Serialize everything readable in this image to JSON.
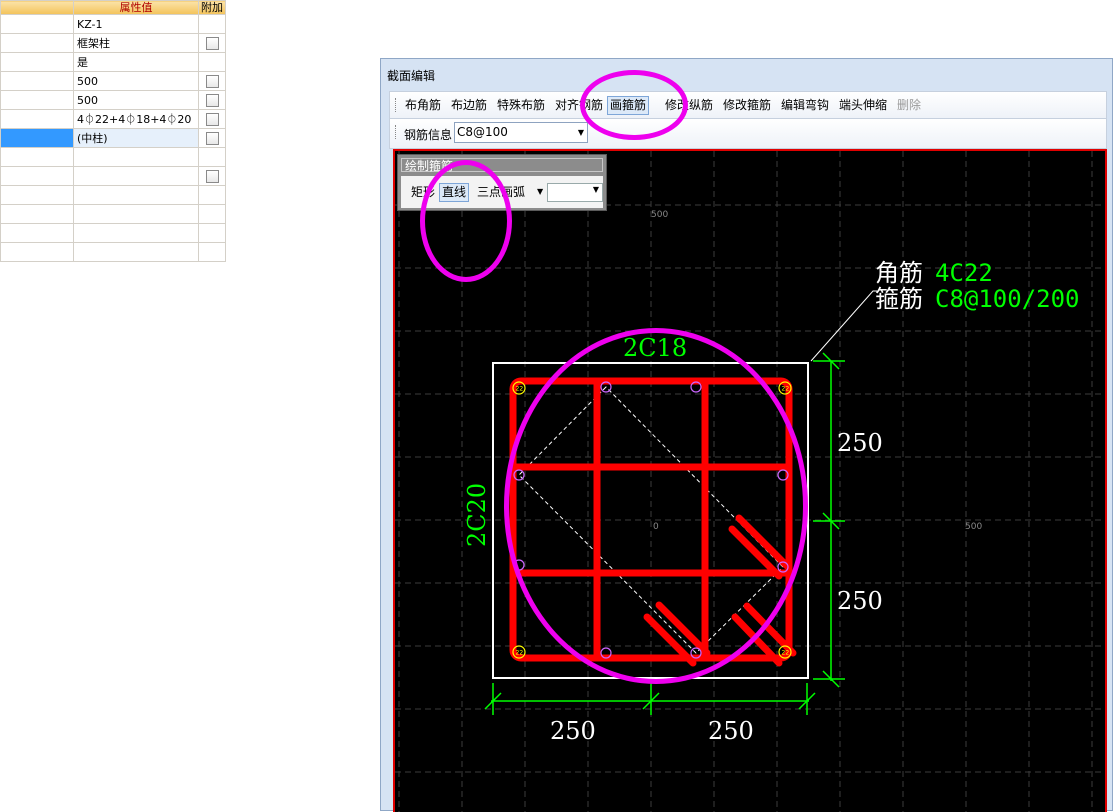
{
  "property_grid": {
    "headers": [
      "属性值",
      "附加"
    ],
    "rows": [
      {
        "value": "KZ-1",
        "checkbox": false
      },
      {
        "value": "框架柱",
        "checkbox": true
      },
      {
        "value": "是",
        "checkbox": false
      },
      {
        "value": "500",
        "checkbox": true
      },
      {
        "value": "500",
        "checkbox": true
      },
      {
        "value": "4⏀22+4⏀18+4⏀20",
        "checkbox": true
      },
      {
        "value": "(中柱)",
        "checkbox": true,
        "selected": true
      },
      {
        "value": "",
        "checkbox": false
      },
      {
        "value": "",
        "checkbox": true
      },
      {
        "value": "",
        "checkbox": false
      },
      {
        "value": "",
        "checkbox": false
      },
      {
        "value": "",
        "checkbox": false
      },
      {
        "value": "",
        "checkbox": false
      }
    ]
  },
  "dialog": {
    "title": "截面编辑",
    "toolbar": [
      "布角筋",
      "布边筋",
      "特殊布筋",
      "对齐钢筋",
      "画箍筋",
      "修改纵筋",
      "修改箍筋",
      "编辑弯钩",
      "端头伸缩",
      "删除"
    ],
    "active_tool": "画箍筋",
    "disabled_tool": "删除",
    "rebar_info_label": "钢筋信息",
    "rebar_info_value": "C8@100"
  },
  "draw_panel": {
    "title": "绘制箍筋",
    "buttons": [
      "矩形",
      "直线",
      "三点画弧"
    ],
    "active": "直线"
  },
  "drawing": {
    "corner_rebar_label": "角筋",
    "corner_rebar_value": "4C22",
    "stirrup_label": "箍筋",
    "stirrup_value": "C8@100/200",
    "top_rebar": "2C18",
    "side_rebar": "2C20",
    "dims_right": [
      "250",
      "250"
    ],
    "dims_bottom": [
      "250",
      "250"
    ],
    "grid_labels": [
      "500",
      "0",
      "500"
    ],
    "bar_dia_corner": "22"
  },
  "colors": {
    "canvas_bg": "#000000",
    "canvas_border": "#e00000",
    "stirrup": "#ff0000",
    "dimension": "#00ff00",
    "annotation": "#ee00ee",
    "corner_bar": "#ffff00",
    "side_bar": "#cc66ff",
    "column_outline": "#ffffff"
  }
}
